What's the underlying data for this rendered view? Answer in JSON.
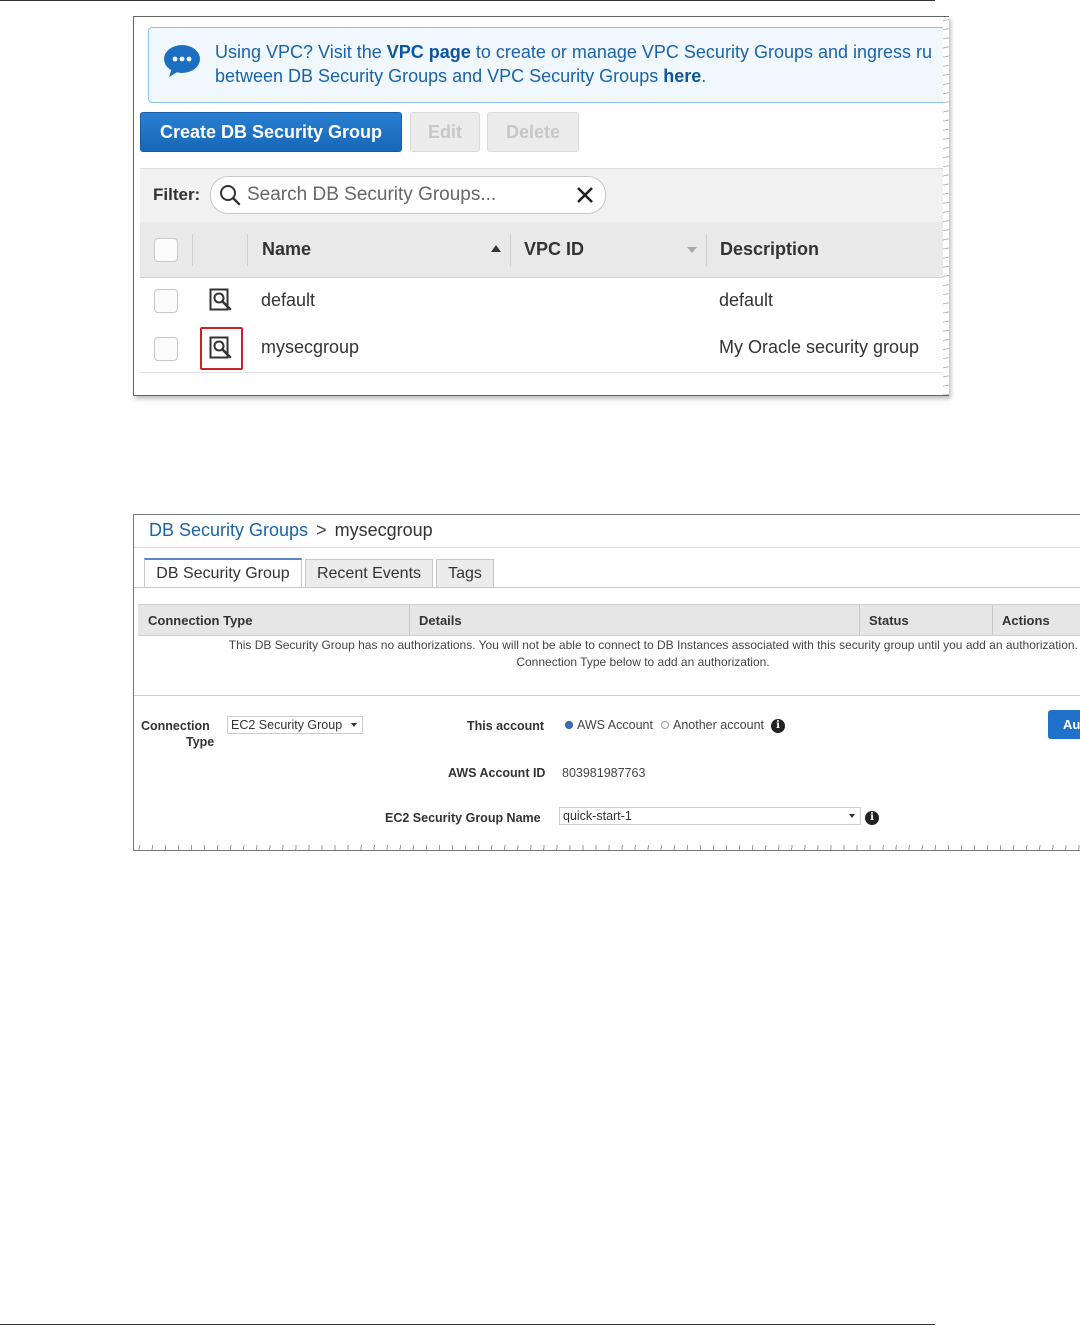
{
  "panel1": {
    "notice": {
      "line1_prefix": "Using VPC? Visit the",
      "line1_link": "VPC page",
      "line1_suffix": "to create or manage VPC Security Groups and ingress ru",
      "line2_prefix": "between DB Security Groups and VPC Security Groups",
      "line2_link": "here",
      "line2_suffix": "."
    },
    "buttons": {
      "create": "Create DB Security Group",
      "edit": "Edit",
      "delete": "Delete"
    },
    "filter": {
      "label": "Filter:",
      "placeholder": "Search DB Security Groups..."
    },
    "columns": {
      "name": "Name",
      "vpc_id": "VPC ID",
      "description": "Description"
    },
    "rows": [
      {
        "name": "default",
        "vpc_id": "",
        "description": "default"
      },
      {
        "name": "mysecgroup",
        "vpc_id": "",
        "description": "My Oracle security group"
      }
    ],
    "colors": {
      "primary_button": "#1767b8",
      "highlight_border": "#c8232c",
      "notice_text": "#1a63a8"
    }
  },
  "panel2": {
    "breadcrumb": {
      "root": "DB Security Groups",
      "separator": ">",
      "current": "mysecgroup"
    },
    "tabs": [
      "DB Security Group",
      "Recent Events",
      "Tags"
    ],
    "grid": {
      "columns": [
        "Connection Type",
        "Details",
        "Status",
        "Actions"
      ],
      "empty_message_line1": "This DB Security Group has no authorizations. You will not be able to connect to DB Instances associated with this security group until you add an authorization. S",
      "empty_message_line2": "Connection Type below to add an authorization."
    },
    "form": {
      "connection_type_label_1": "Connection",
      "connection_type_label_2": "Type",
      "connection_type_value": "EC2 Security Group",
      "this_account_label": "This account",
      "radio_aws": "AWS Account",
      "radio_another": "Another account",
      "aws_account_id_label": "AWS Account ID",
      "aws_account_id_value": "803981987763",
      "ec2_group_name_label": "EC2 Security Group Name",
      "ec2_group_name_value": "quick-start-1",
      "authorize_button": "Au"
    }
  }
}
